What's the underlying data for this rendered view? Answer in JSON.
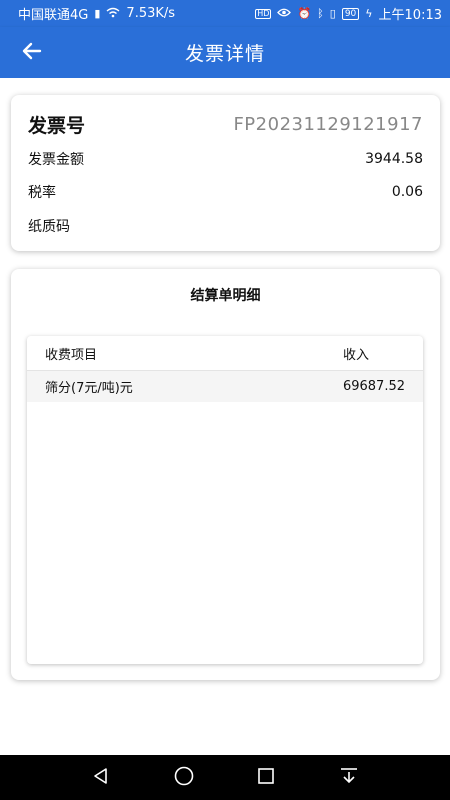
{
  "status_bar": {
    "carrier": "中国联通4G",
    "signal_icon": "signal-icon",
    "speed": "7.53K/s",
    "battery": "90",
    "time": "上午10:13"
  },
  "app_bar": {
    "title": "发票详情",
    "back_icon": "arrow-left-icon"
  },
  "invoice": {
    "number_label": "发票号",
    "number_value": "FP20231129121917",
    "amount_label": "发票金额",
    "amount_value": "3944.58",
    "tax_rate_label": "税率",
    "tax_rate_value": "0.06",
    "paper_code_label": "纸质码",
    "paper_code_value": ""
  },
  "settlement": {
    "title": "结算单明细",
    "columns": [
      "收费项目",
      "收入"
    ],
    "rows": [
      {
        "item": "筛分(7元/吨)元",
        "income": "69687.52"
      }
    ]
  },
  "nav_bar": {
    "back_icon": "triangle-back-icon",
    "home_icon": "circle-home-icon",
    "recent_icon": "square-recent-icon",
    "extra_icon": "download-down-icon"
  },
  "colors": {
    "primary": "#2a6fd8",
    "muted_text": "#888888"
  }
}
